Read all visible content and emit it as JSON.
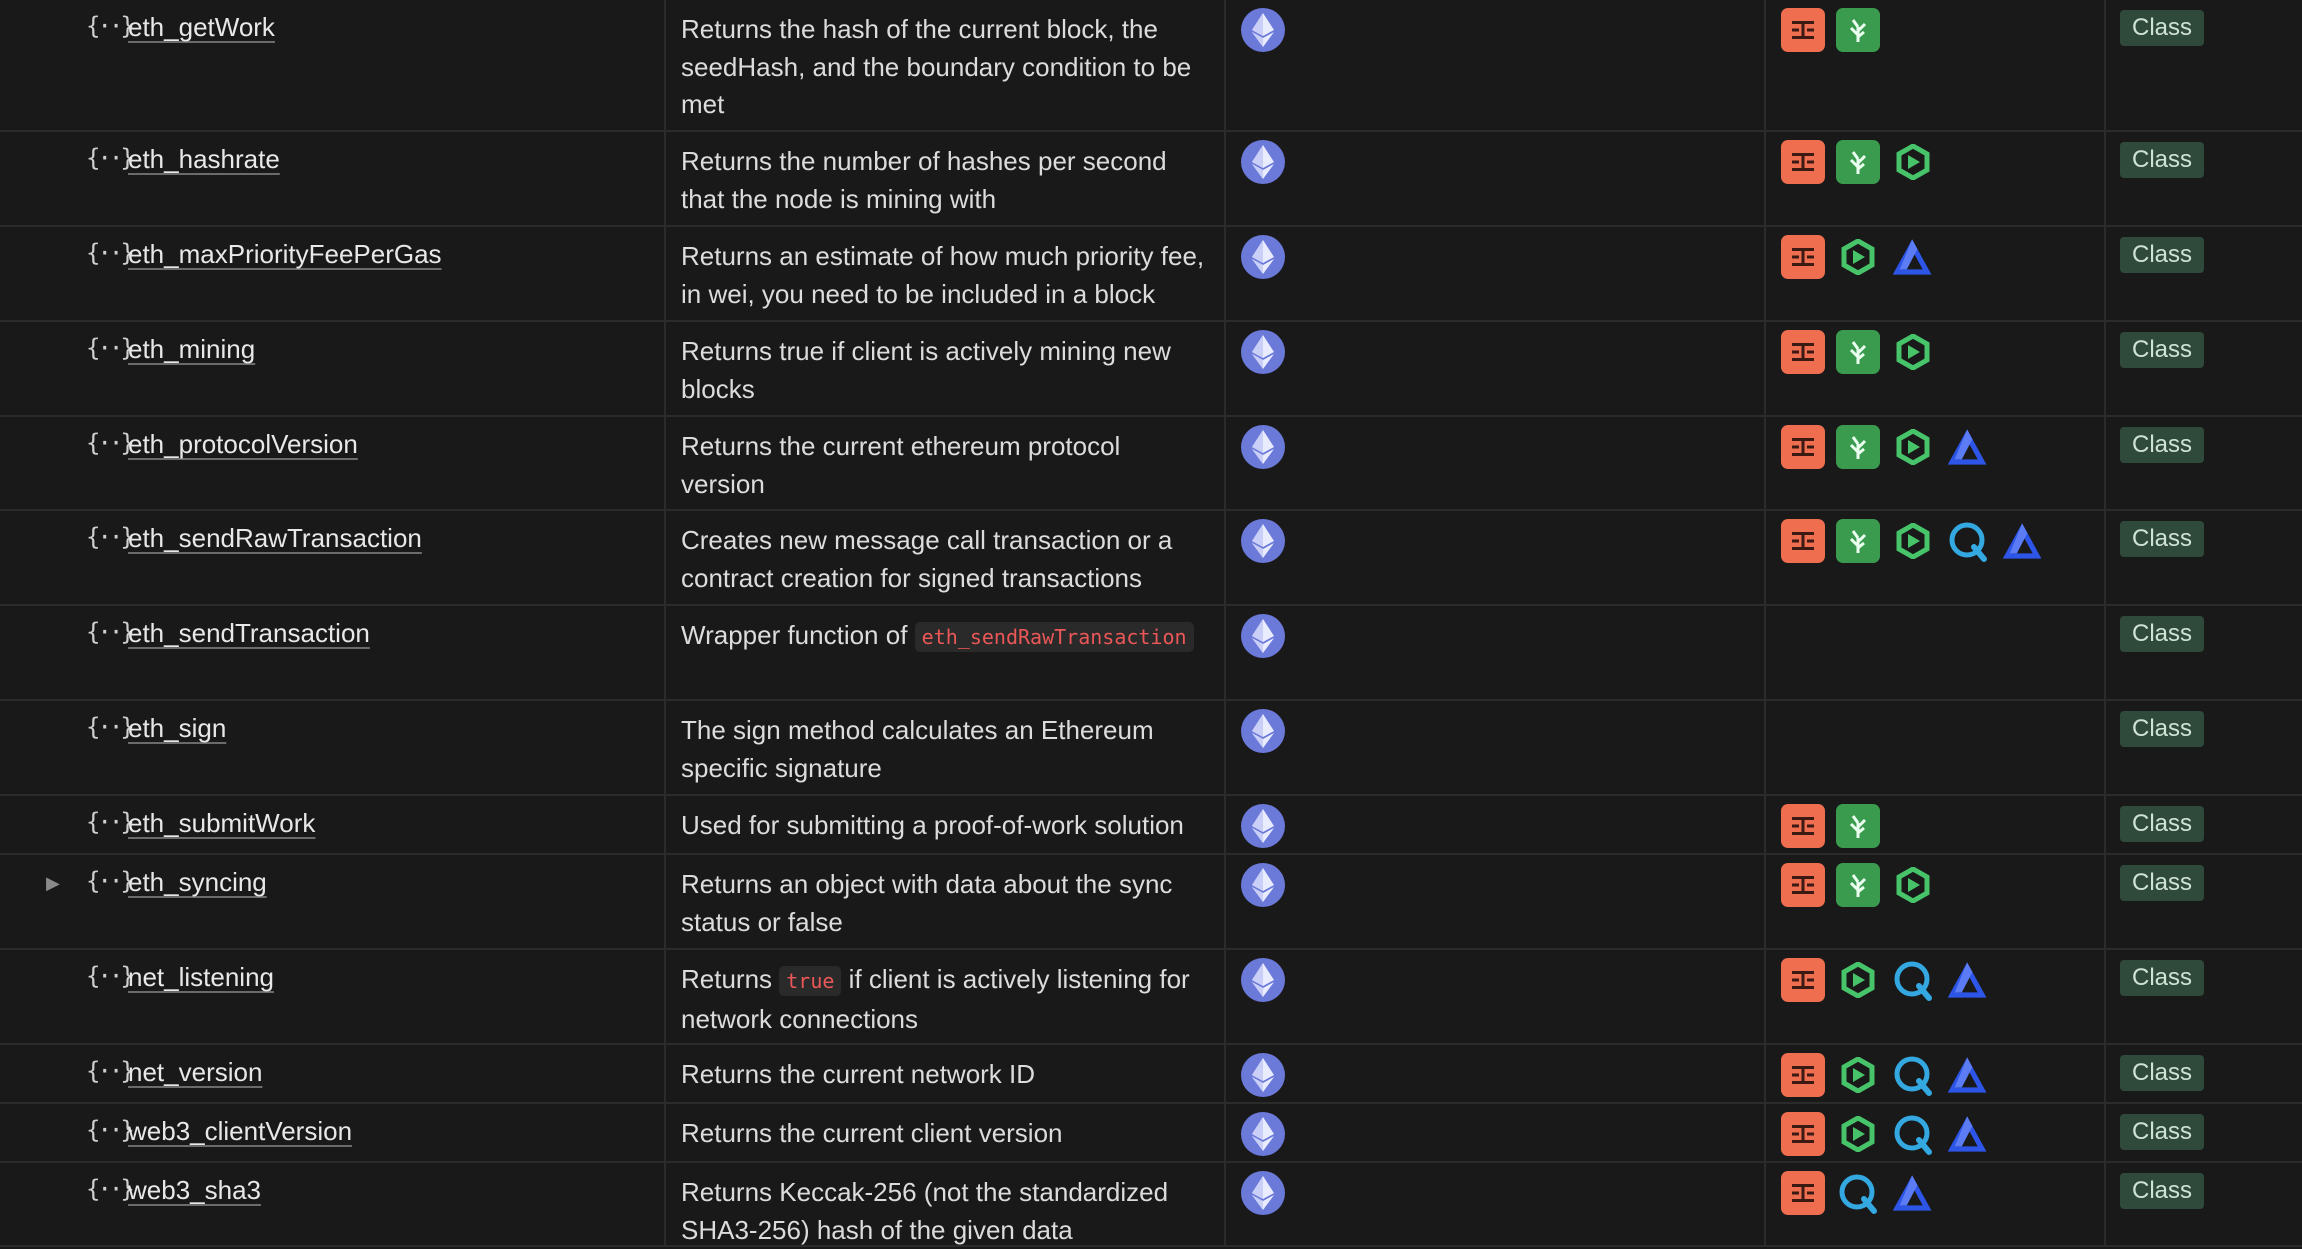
{
  "tag_label": "Class",
  "icons": {
    "network": "ethereum-icon",
    "providers": {
      "a": "orange-provider-icon",
      "b": "green-leaf-provider-icon",
      "c": "green-hexagon-provider-icon",
      "d": "blue-q-provider-icon",
      "e": "blue-triangle-provider-icon"
    }
  },
  "rows": [
    {
      "name": "eth_getWork",
      "desc": "Returns the hash of the current block, the seedHash, and the boundary condition to be met",
      "providers": [
        "a",
        "b"
      ]
    },
    {
      "name": "eth_hashrate",
      "desc": "Returns the number of hashes per second that the node is mining with",
      "providers": [
        "a",
        "b",
        "c"
      ]
    },
    {
      "name": "eth_maxPriorityFeePerGas",
      "desc": "Returns an estimate of how much priority fee, in wei, you need to be included in a block",
      "providers": [
        "a",
        "c",
        "e"
      ]
    },
    {
      "name": "eth_mining",
      "desc": "Returns true if client is actively mining new blocks",
      "providers": [
        "a",
        "b",
        "c"
      ]
    },
    {
      "name": "eth_protocolVersion",
      "desc": "Returns the current ethereum protocol version",
      "providers": [
        "a",
        "b",
        "c",
        "e"
      ]
    },
    {
      "name": "eth_sendRawTransaction",
      "desc": "Creates new message call transaction or a contract creation for signed transactions",
      "providers": [
        "a",
        "b",
        "c",
        "d",
        "e"
      ]
    },
    {
      "name": "eth_sendTransaction",
      "desc_pre": "Wrapper function of ",
      "desc_code": "eth_sendRawTransaction",
      "desc_post": "",
      "providers": []
    },
    {
      "name": "eth_sign",
      "desc": "The sign method calculates an Ethereum specific signature",
      "providers": []
    },
    {
      "name": "eth_submitWork",
      "desc": "Used for submitting a proof-of-work solution",
      "providers": [
        "a",
        "b"
      ]
    },
    {
      "name": "eth_syncing",
      "desc": "Returns an object with data about the sync status or false",
      "providers": [
        "a",
        "b",
        "c"
      ],
      "toggle": "▶"
    },
    {
      "name": "net_listening",
      "desc_pre": "Returns ",
      "desc_code": "true",
      "desc_post": " if client is actively listening for network connections",
      "providers": [
        "a",
        "c",
        "d",
        "e"
      ]
    },
    {
      "name": "net_version",
      "desc": "Returns the current network ID",
      "providers": [
        "a",
        "c",
        "d",
        "e"
      ]
    },
    {
      "name": "web3_clientVersion",
      "desc": "Returns the current client version",
      "providers": [
        "a",
        "c",
        "d",
        "e"
      ]
    },
    {
      "name": "web3_sha3",
      "desc": "Returns Keccak-256 (not the standardized SHA3-256) hash of the given data",
      "providers": [
        "a",
        "d",
        "e"
      ]
    }
  ]
}
